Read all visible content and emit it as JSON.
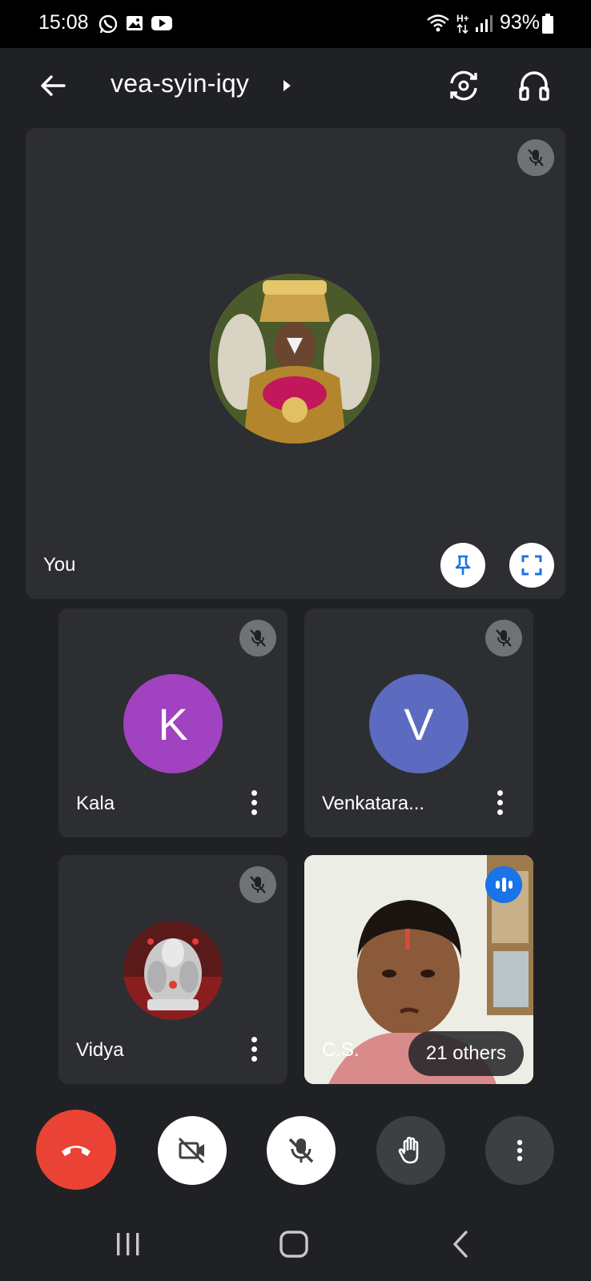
{
  "status_bar": {
    "time": "15:08",
    "notification_icons": [
      "whatsapp-icon",
      "image-icon",
      "youtube-icon"
    ],
    "network": "H+",
    "battery": "93%"
  },
  "top_bar": {
    "meeting_code": "vea-syin-iqy",
    "back_icon": "arrow-left-icon",
    "switch_camera_icon": "switch-camera-icon",
    "audio_output_icon": "headphones-icon"
  },
  "self_tile": {
    "name": "You",
    "muted": true,
    "pin_icon": "pin-icon",
    "fullscreen_icon": "fullscreen-icon"
  },
  "participants": [
    {
      "name": "Kala",
      "initial": "K",
      "avatar_color": "#a142c0",
      "muted": true
    },
    {
      "name": "Venkatara...",
      "initial": "V",
      "avatar_color": "#5c6bc0",
      "muted": true
    },
    {
      "name": "Vidya",
      "initial": "",
      "avatar_color": "",
      "muted": true
    },
    {
      "name": "C.S.",
      "speaking": true,
      "others_label": "21 others"
    }
  ],
  "controls": {
    "end_call_icon": "end-call-icon",
    "camera_icon": "camera-off-icon",
    "mic_icon": "mic-off-icon",
    "raise_hand_icon": "raise-hand-icon",
    "more_icon": "more-vert-icon",
    "end_call_color": "#ea4335"
  },
  "nav_bar": {
    "recents_icon": "recents-icon",
    "home_icon": "home-icon",
    "back_icon": "nav-back-icon"
  }
}
